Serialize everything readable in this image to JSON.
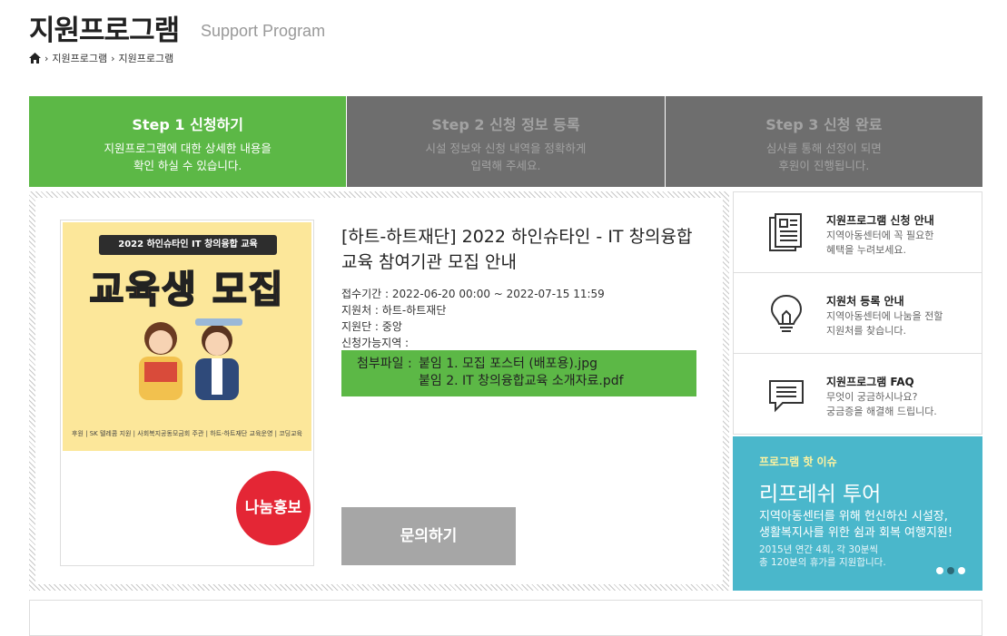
{
  "header": {
    "title": "지원프로그램",
    "subtitle": "Support Program",
    "breadcrumb": [
      "지원프로그램",
      "지원프로그램"
    ]
  },
  "steps": [
    {
      "title": "Step 1 신청하기",
      "desc1": "지원프로그램에 대한 상세한 내용을",
      "desc2": "확인 하실 수 있습니다."
    },
    {
      "title": "Step 2 신청 정보 등록",
      "desc1": "시설 정보와 신청 내역을 정확하게",
      "desc2": "입력해 주세요."
    },
    {
      "title": "Step 3 신청 완료",
      "desc1": "심사를 통해 선정이 되면",
      "desc2": "후원이 진행됩니다."
    }
  ],
  "post": {
    "poster_tag": "2022 하인슈타인 IT 창의융합 교육",
    "poster_headline": "교육생 모집",
    "poster_footer": [
      "후원 | SK 텔레콤",
      "지원 | 사회복지공동모금회",
      "주관 | 하트-하트재단",
      "교육운영 | 코딩교육"
    ],
    "badge": "나눔홍보",
    "title": "[하트-하트재단] 2022 하인슈타인 - IT 창의융합 교육 참여기관 모집 안내",
    "period": "접수기간 : 2022-06-20 00:00 ~ 2022-07-15 11:59",
    "sponsor": "지원처 : 하트-하트재단",
    "unit": "지원단 : 중앙",
    "region": "신청가능지역 :",
    "attach_label": "첨부파일 :",
    "attachments": [
      "붙임 1. 모집 포스터 (배포용).jpg",
      "붙임 2. IT 창의융합교육 소개자료.pdf"
    ],
    "inquiry_button": "문의하기"
  },
  "sidebar": [
    {
      "icon": "document-icon",
      "title": "지원프로그램 신청 안내",
      "desc1": "지역아동센터에 꼭 필요한",
      "desc2": "혜택을 누려보세요."
    },
    {
      "icon": "lightbulb-icon",
      "title": "지원처 등록 안내",
      "desc1": "지역아동센터에 나눔을 전할",
      "desc2": "지원처를 찾습니다."
    },
    {
      "icon": "chat-icon",
      "title": "지원프로그램 FAQ",
      "desc1": "무엇이 궁금하시나요?",
      "desc2": "궁금증을 해결해 드립니다."
    }
  ],
  "promo": {
    "kicker": "프로그램 핫 이슈",
    "title": "리프레쉬 투어",
    "text1": "지역아동센터를 위해 헌신하신 시설장,",
    "text2": "생활복지사를 위한 쉼과 회복 여행지원!",
    "small1": "2015년 연간 4회, 각 30분씩",
    "small2": "총 120분의 휴가를 지원합니다."
  },
  "colors": {
    "active_step": "#5cb846",
    "inactive_step": "#6e6e6e",
    "badge": "#e42635",
    "promo": "#4ab7cb"
  }
}
